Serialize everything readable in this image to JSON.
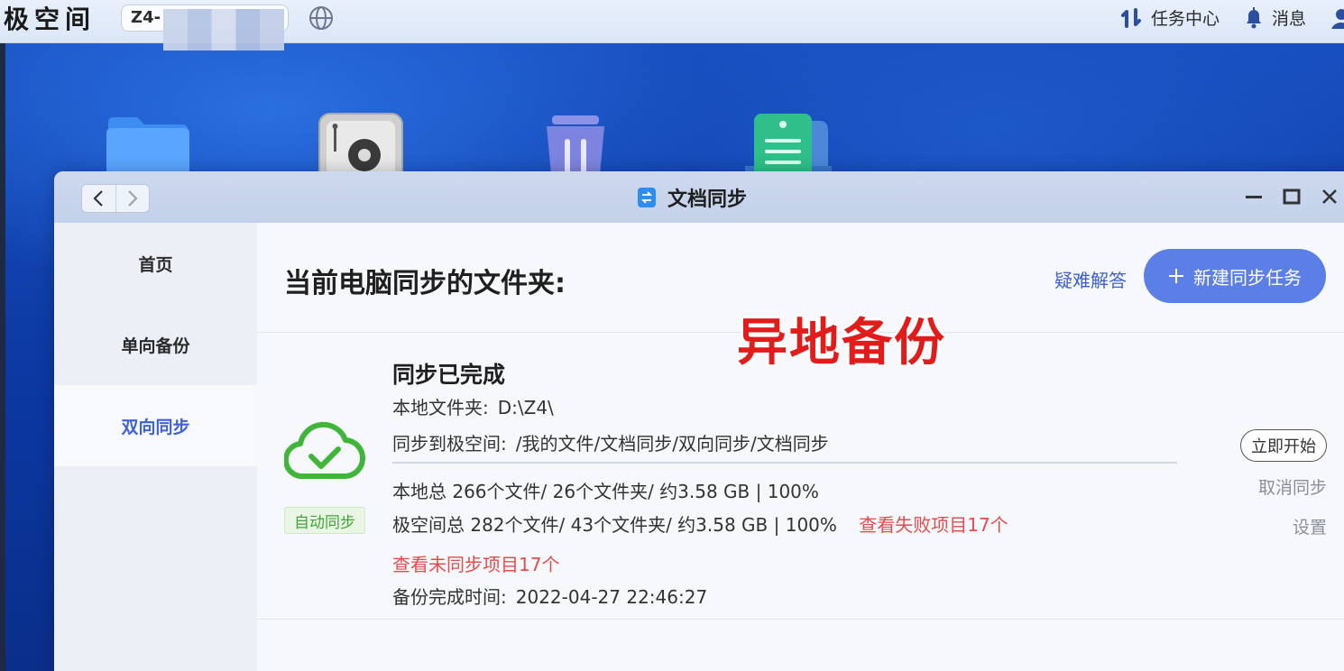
{
  "topbar": {
    "logo": "极空间",
    "device_name": "Z4-",
    "task_center": "任务中心",
    "messages": "消息"
  },
  "window": {
    "title": "文档同步"
  },
  "sidebar": {
    "items": [
      {
        "label": "首页"
      },
      {
        "label": "单向备份"
      },
      {
        "label": "双向同步"
      }
    ]
  },
  "main": {
    "page_title": "当前电脑同步的文件夹:",
    "help_link": "疑难解答",
    "new_task_button": "新建同步任务",
    "overlay_stamp": "异地备份",
    "task": {
      "status": "同步已完成",
      "local_folder_label": "本地文件夹:",
      "local_folder_value": "D:\\Z4\\",
      "remote_label": "同步到极空间:",
      "remote_value": "/我的文件/文档同步/双向同步/文档同步",
      "local_stats": "本地总 266个文件/ 26个文件夹/ 约3.58 GB | 100%",
      "remote_stats": "极空间总 282个文件/ 43个文件夹/ 约3.58 GB | 100%",
      "failed_link": "查看失败项目17个",
      "unsynced_link": "查看未同步项目17个",
      "finish_time_label": "备份完成时间:",
      "finish_time_value": "2022-04-27 22:46:27",
      "auto_badge": "自动同步",
      "start_now": "立即开始",
      "cancel_sync": "取消同步",
      "settings": "设置"
    }
  },
  "colors": {
    "accent": "#5b7fe6",
    "link": "#3d5fd1",
    "error": "#e74c4c",
    "success": "#42a535",
    "stamp": "#e21b1b"
  }
}
